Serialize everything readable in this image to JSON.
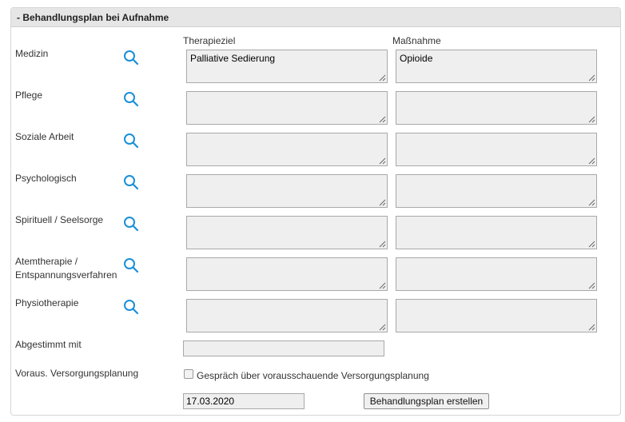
{
  "section": {
    "title": "- Behandlungsplan bei Aufnahme"
  },
  "columns": {
    "goal": "Therapieziel",
    "measure": "Maßnahme"
  },
  "rows": [
    {
      "label": "Medizin",
      "goal": "Palliative Sedierung",
      "measure": "Opioide"
    },
    {
      "label": "Pflege",
      "goal": "",
      "measure": ""
    },
    {
      "label": "Soziale Arbeit",
      "goal": "",
      "measure": ""
    },
    {
      "label": "Psychologisch",
      "goal": "",
      "measure": ""
    },
    {
      "label": "Spirituell / Seelsorge",
      "goal": "",
      "measure": ""
    },
    {
      "label_line1": "Atemtherapie /",
      "label_line2": "Entspannungsverfahren",
      "goal": "",
      "measure": ""
    },
    {
      "label": "Physiotherapie",
      "goal": "",
      "measure": ""
    }
  ],
  "agreed": {
    "label": "Abgestimmt mit",
    "value": ""
  },
  "planning": {
    "label": "Voraus. Versorgungsplanung",
    "checkbox_label": "Gespräch über vorausschauende Versorgungsplanung",
    "checked": false
  },
  "date": {
    "value": "17.03.2020"
  },
  "create_button": {
    "label": "Behandlungsplan erstellen"
  },
  "icons": {
    "search": "search-icon",
    "accent": "#1a8fd8"
  }
}
